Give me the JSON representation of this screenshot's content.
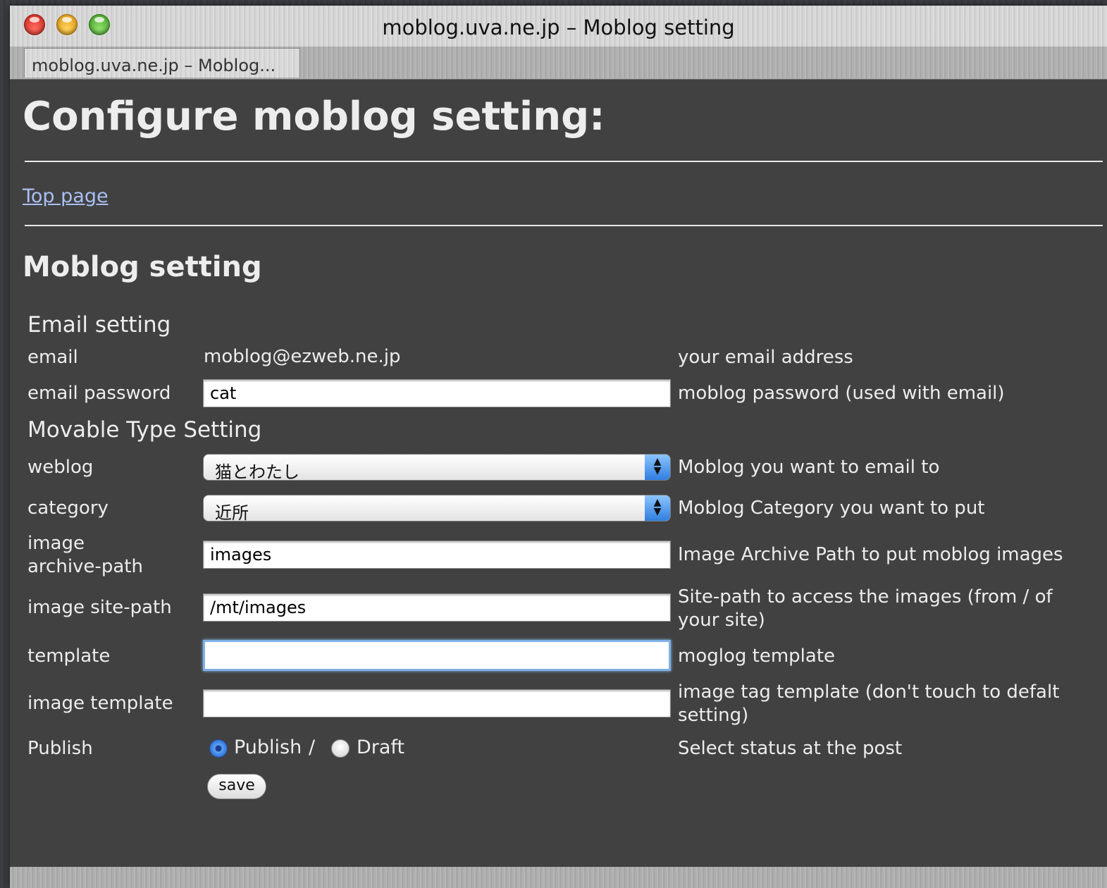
{
  "window": {
    "title": "moblog.uva.ne.jp – Moblog setting",
    "tab_label": "moblog.uva.ne.jp – Moblog..."
  },
  "page": {
    "heading": "Configure moblog setting:",
    "top_link": "Top page",
    "subheading": "Moblog setting"
  },
  "email_section": {
    "title": "Email setting",
    "email_label": "email",
    "email_value": "moblog@ezweb.ne.jp",
    "email_desc": "your email address",
    "password_label": "email password",
    "password_value": "cat",
    "password_desc": "moblog password (used with email)"
  },
  "mt_section": {
    "title": "Movable Type Setting",
    "weblog_label": "weblog",
    "weblog_value": "猫とわたし",
    "weblog_desc": "Moblog you want to email to",
    "category_label": "category",
    "category_value": "近所",
    "category_desc": "Moblog Category you want to put",
    "archive_label_1": "image",
    "archive_label_2": "archive-path",
    "archive_value": "images",
    "archive_desc": "Image Archive Path to put moblog images",
    "sitepath_label": "image site-path",
    "sitepath_value": "/mt/images",
    "sitepath_desc_1": "Site-path to access the images (from / of",
    "sitepath_desc_2": "your site)",
    "template_label": "template",
    "template_value": "",
    "template_desc": "moglog template",
    "imgtemplate_label": "image template",
    "imgtemplate_value": "",
    "imgtemplate_desc_1": "image tag template (don't touch to defalt",
    "imgtemplate_desc_2": "setting)",
    "publish_label": "Publish",
    "publish_option": "Publish",
    "separator": "/",
    "draft_option": "Draft",
    "publish_selected": "Publish",
    "publish_desc": "Select status at the post"
  },
  "save_label": "save",
  "icons": {
    "close": "close-light-icon",
    "minimize": "minimize-light-icon",
    "zoom": "zoom-light-icon",
    "select_arrows": "updown-arrows-icon"
  },
  "colors": {
    "background": "#414141",
    "text": "#ededed",
    "link": "#a9bff4"
  }
}
